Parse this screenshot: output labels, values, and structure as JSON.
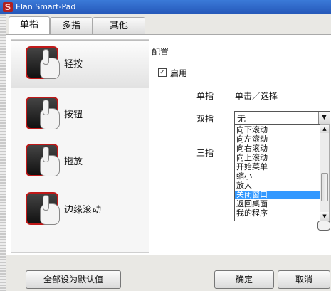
{
  "window": {
    "title": "Elan Smart-Pad"
  },
  "tabs": [
    {
      "label": "单指"
    },
    {
      "label": "多指"
    },
    {
      "label": "其他"
    }
  ],
  "nav": [
    {
      "label": "轻按",
      "icon": "tap-gesture-icon"
    },
    {
      "label": "按钮",
      "icon": "button-gesture-icon"
    },
    {
      "label": "拖放",
      "icon": "drag-drop-gesture-icon"
    },
    {
      "label": "边缘滚动",
      "icon": "edge-scroll-gesture-icon"
    }
  ],
  "config": {
    "title": "配置",
    "enable_label": "启用",
    "enabled": true,
    "single_label": "单指",
    "single_value": "单击／选择",
    "double_label": "双指",
    "double_value": "无",
    "triple_label": "三指"
  },
  "dropdown": {
    "options": [
      "向下滚动",
      "向左滚动",
      "向右滚动",
      "向上滚动",
      "开始菜单",
      "缩小",
      "放大",
      "关闭窗口",
      "返回桌面",
      "我的程序"
    ],
    "highlighted": "关闭窗口"
  },
  "buttons": {
    "defaults": "全部设为默认值",
    "ok": "确定",
    "cancel": "取消"
  }
}
